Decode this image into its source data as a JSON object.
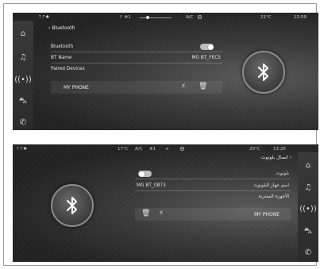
{
  "screen_en": {
    "status": {
      "left_icons": "⇡⇡✱",
      "center_icons": "⚐ ❄1",
      "ac": "A/C",
      "temp": "21°C",
      "time": "12:59"
    },
    "back_label": "Bluetooth",
    "bluetooth_label": "Bluetooth",
    "bt_name_label": "BT Name",
    "bt_name_value": "MG BT_FEC5",
    "paired_devices_label": "Paired Devices",
    "device_name": "MY PHONE"
  },
  "screen_ar": {
    "status": {
      "left_icons": "⇡⇡✱",
      "temp_left": "17°C",
      "ac": "A/C",
      "fan": "❄1",
      "temp": "20°C",
      "time": "13:20"
    },
    "back_label": "اتصال بلوتوث",
    "bluetooth_label": "بلوتوث",
    "bt_name_label": "اسم جهاز البلوتوث",
    "bt_name_value": "MG BT_0B73",
    "paired_devices_label": "الأجهزة المقترنة",
    "device_name": "MY PHONE"
  },
  "sidebar_icons": [
    "home-icon",
    "music-icon",
    "radio-icon",
    "car-icon",
    "phone-icon"
  ],
  "bluetooth_enabled": true,
  "colors": {
    "background": "#2a2a2a",
    "text": "#e6e6e6",
    "toggle": "#bdbdbd"
  }
}
